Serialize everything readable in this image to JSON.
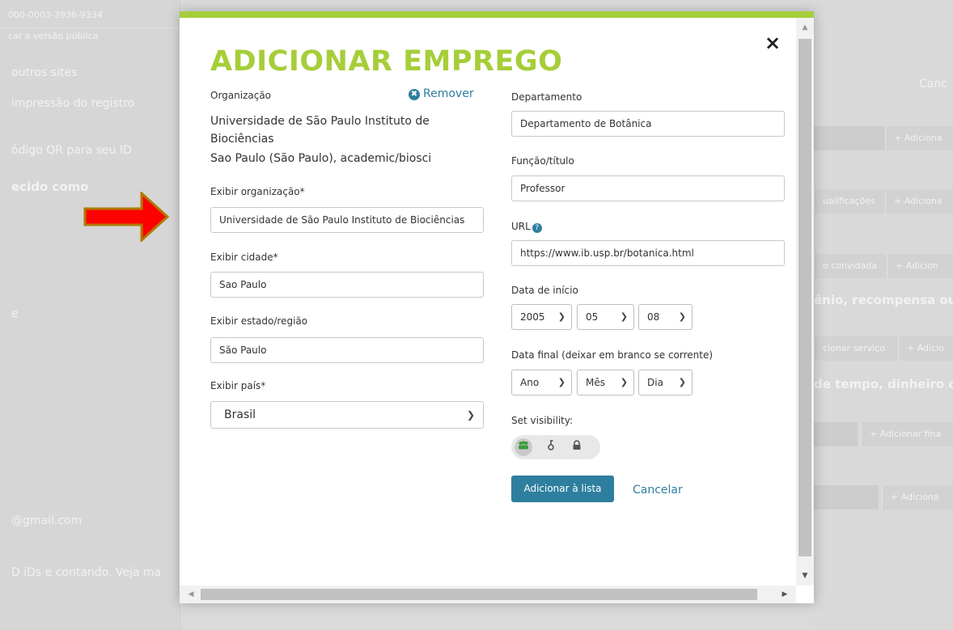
{
  "background": {
    "left_items": [
      "000-0003-3936-9334",
      "car a versão pública",
      "outros sites",
      "impressão do registro",
      "ódigo QR para seu ID",
      "ecido como",
      "e",
      "@gmail.com",
      "D iDs e contando. Veja ma"
    ],
    "right_items": [
      "Canc",
      "+ Adiciona",
      "ualificações",
      "+ Adiciona",
      "o convidada",
      "+ Adicion",
      "ênio, recompensa ou",
      "cionar serviço",
      "+ Adicio",
      "de tempo, dinheiro o",
      "+ Adicionar fina",
      "+ Adiciona"
    ]
  },
  "modal": {
    "title": "ADICIONAR EMPREGO",
    "close_label": "×",
    "left": {
      "organization_label": "Organização",
      "remove_label": "Remover",
      "org_name_line1": "Universidade de São Paulo Instituto de",
      "org_name_line2": "Biociências",
      "org_location": "Sao Paulo (São Paulo), academic/biosci",
      "display_org_label": "Exibir organização*",
      "display_org_value": "Universidade de São Paulo Instituto de Biociências",
      "display_city_label": "Exibir cidade*",
      "display_city_value": "Sao Paulo",
      "display_state_label": "Exibir estado/região",
      "display_state_value": "São Paulo",
      "display_country_label": "Exibir país*",
      "display_country_value": "Brasil"
    },
    "right": {
      "department_label": "Departamento",
      "department_value": "Departamento de Botânica",
      "role_label": "Função/título",
      "role_value": "Professor",
      "url_label": "URL",
      "url_value": "https://www.ib.usp.br/botanica.html",
      "start_date_label": "Data de início",
      "start_year": "2005",
      "start_month": "05",
      "start_day": "08",
      "end_date_label": "Data final (deixar em branco se corrente)",
      "end_year": "Ano",
      "end_month": "Mês",
      "end_day": "Dia",
      "visibility_label": "Set visibility:",
      "add_button": "Adicionar à lista",
      "cancel_link": "Cancelar"
    }
  },
  "colors": {
    "accent_green": "#a6ce39",
    "link_blue": "#2e7f9f",
    "arrow_red": "#ff0000",
    "arrow_outline": "#b07a00"
  }
}
